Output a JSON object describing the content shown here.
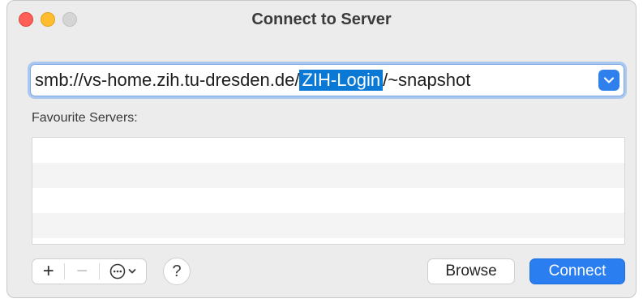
{
  "window": {
    "title": "Connect to Server"
  },
  "address": {
    "prefix": "smb://vs-home.zih.tu-dresden.de/",
    "selected": "ZIH-Login",
    "suffix": "/~snapshot"
  },
  "favourites": {
    "label": "Favourite Servers:",
    "items": []
  },
  "toolbar": {
    "add_label": "+",
    "remove_label": "−",
    "help_label": "?"
  },
  "buttons": {
    "browse_label": "Browse",
    "connect_label": "Connect"
  },
  "colors": {
    "accent": "#2a7ef0",
    "selection": "#0a79d6"
  }
}
